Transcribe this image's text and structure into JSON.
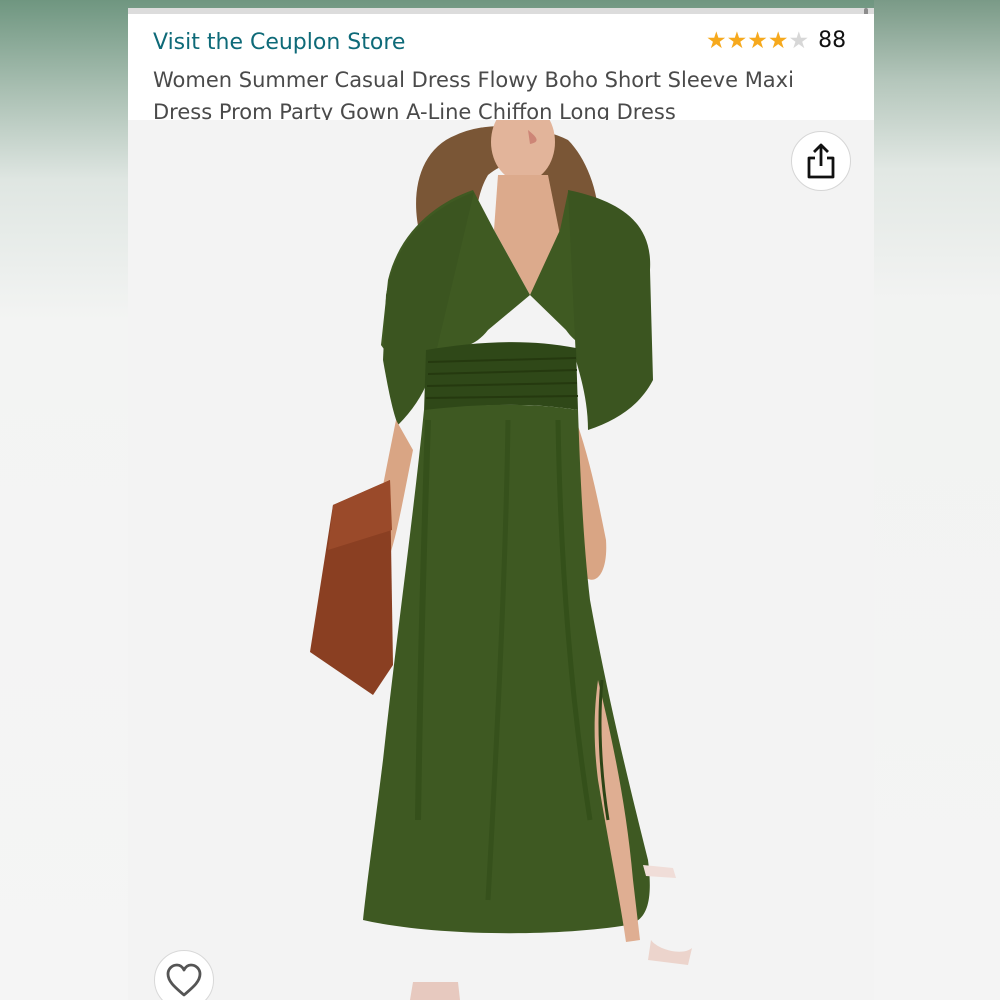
{
  "header": {
    "store_link": "Visit the Ceuplon Store",
    "rating": {
      "value": 4.0,
      "max": 5,
      "count": "88",
      "star_color": "#f6a91d"
    },
    "title": "Women Summer Casual Dress Flowy Boho Short Sleeve Maxi Dress Prom Party Gown A-Line Chiffon Long Dress",
    "link_color": "#0e6a78"
  },
  "image": {
    "icons": {
      "share": "share-icon",
      "favorite": "heart-icon"
    },
    "colors": {
      "dress": "#3f5a22",
      "clutch": "#8a3f22",
      "hair": "#7a5636"
    }
  }
}
